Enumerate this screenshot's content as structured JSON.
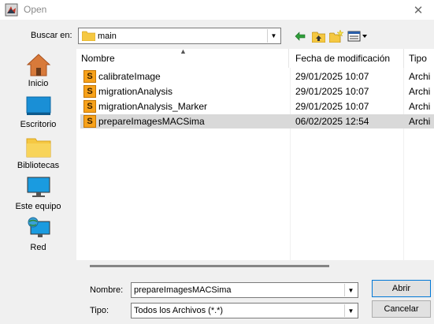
{
  "window": {
    "title": "Open",
    "close_glyph": "✕"
  },
  "lookin": {
    "label": "Buscar en:",
    "value": "main"
  },
  "toolbar": {
    "back_icon": "back-arrow-icon",
    "up_icon": "up-folder-icon",
    "new_icon": "new-folder-icon",
    "view_icon": "view-menu-icon"
  },
  "places": [
    {
      "label": "Inicio",
      "icon": "home-icon"
    },
    {
      "label": "Escritorio",
      "icon": "desktop-icon"
    },
    {
      "label": "Bibliotecas",
      "icon": "libraries-icon"
    },
    {
      "label": "Este equipo",
      "icon": "this-pc-icon"
    },
    {
      "label": "Red",
      "icon": "network-icon"
    }
  ],
  "columns": {
    "name": "Nombre",
    "date": "Fecha de modificación",
    "type": "Tipo"
  },
  "files": [
    {
      "name": "calibrateImage",
      "date": "29/01/2025 10:07",
      "type": "Archi"
    },
    {
      "name": "migrationAnalysis",
      "date": "29/01/2025 10:07",
      "type": "Archi"
    },
    {
      "name": "migrationAnalysis_Marker",
      "date": "29/01/2025 10:07",
      "type": "Archi"
    },
    {
      "name": "prepareImagesMACSima",
      "date": "06/02/2025 12:54",
      "type": "Archi"
    }
  ],
  "filename": {
    "label": "Nombre:",
    "value": "prepareImagesMACSima"
  },
  "filetype": {
    "label": "Tipo:",
    "value": "Todos los Archivos (*.*)"
  },
  "buttons": {
    "open": "Abrir",
    "cancel": "Cancelar"
  },
  "colors": {
    "selection": "#d9d9d9",
    "default_button_border": "#0078d7",
    "file_icon": "#f7a21b"
  }
}
